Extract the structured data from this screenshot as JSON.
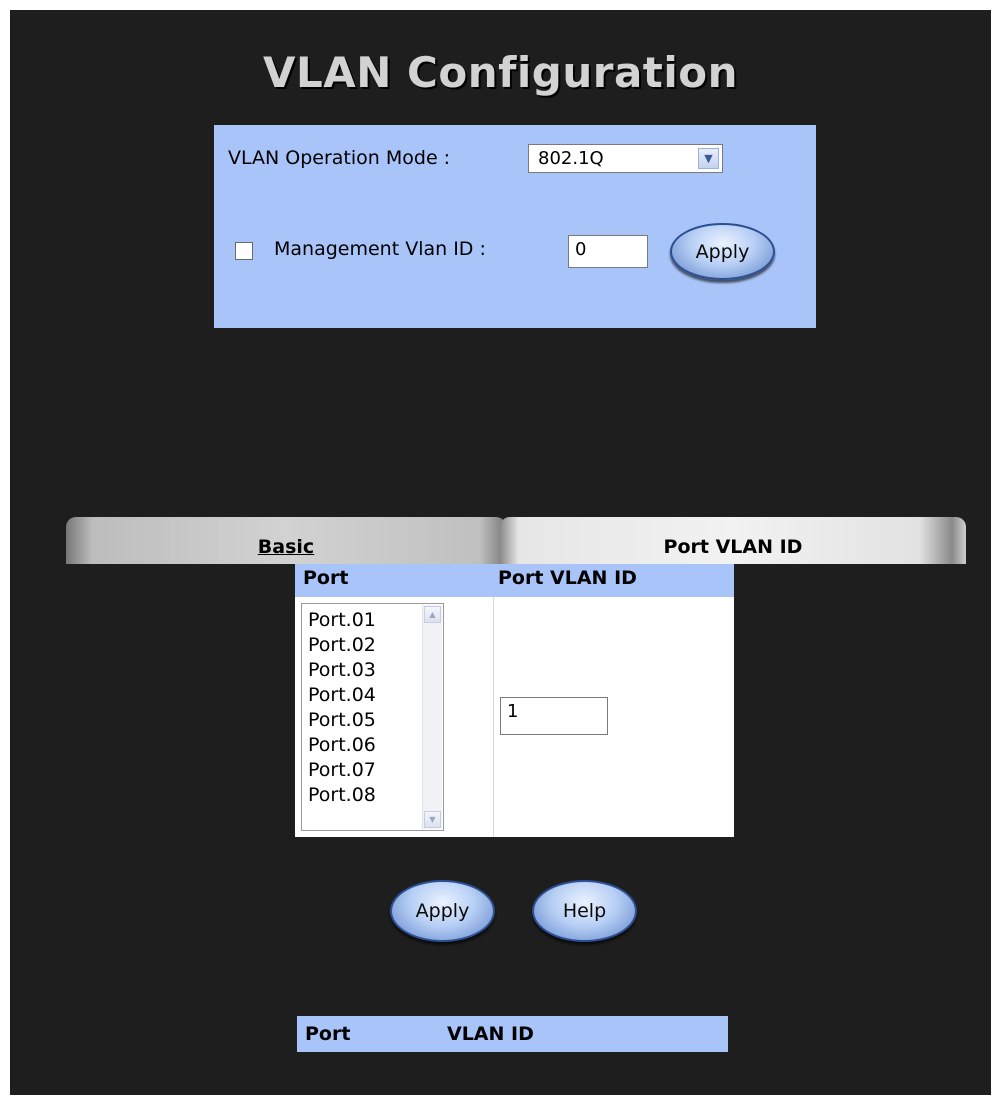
{
  "page": {
    "title": "VLAN Configuration"
  },
  "config": {
    "mode_label": "VLAN Operation Mode :",
    "mode_value": "802.1Q",
    "mgmt_label": "Management Vlan ID :",
    "mgmt_checked": false,
    "mgmt_value": "0",
    "apply_label": "Apply"
  },
  "tabs": {
    "basic_label": "Basic",
    "port_vlan_id_label": "Port VLAN ID"
  },
  "grid": {
    "col_port": "Port",
    "col_pvid": "Port VLAN ID",
    "ports": [
      "Port.01",
      "Port.02",
      "Port.03",
      "Port.04",
      "Port.05",
      "Port.06",
      "Port.07",
      "Port.08"
    ],
    "pvid_value": "1"
  },
  "actions": {
    "apply_label": "Apply",
    "help_label": "Help"
  },
  "summary": {
    "col_port": "Port",
    "col_vlan_id": "VLAN ID"
  },
  "colors": {
    "panel_blue": "#a8c4f8",
    "background": "#1e1e1e",
    "title": "#d2d2d2"
  }
}
